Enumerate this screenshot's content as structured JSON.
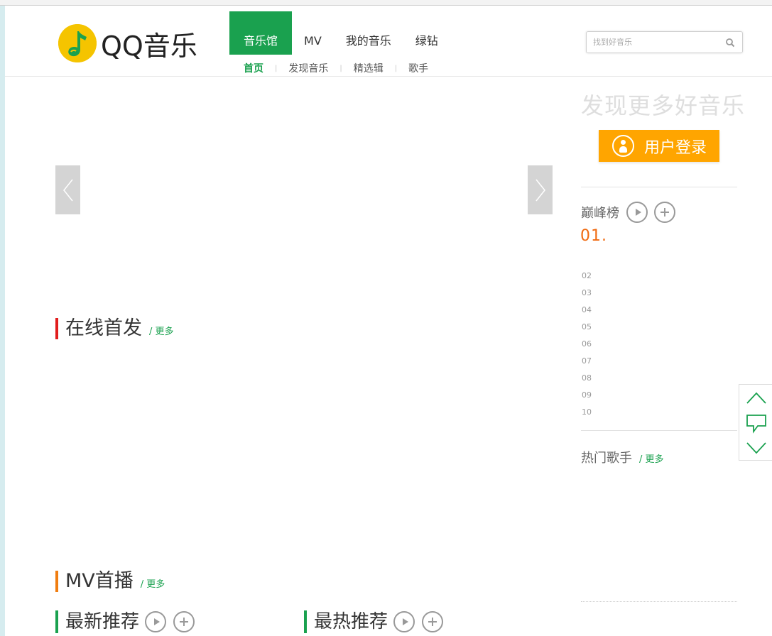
{
  "brand": {
    "name": "QQ音乐",
    "color": "#1aa14f",
    "logo_color": "#f5c400"
  },
  "nav": {
    "items": [
      {
        "label": "音乐馆",
        "active": true
      },
      {
        "label": "MV"
      },
      {
        "label": "我的音乐"
      },
      {
        "label": "绿钻"
      }
    ]
  },
  "subnav": {
    "items": [
      {
        "label": "首页",
        "active": true
      },
      {
        "label": "发现音乐"
      },
      {
        "label": "精选辑"
      },
      {
        "label": "歌手"
      }
    ],
    "separator": "|"
  },
  "search": {
    "placeholder": "找到好音乐",
    "icon": "search-icon"
  },
  "slider": {
    "prev_icon": "chevron-left-icon",
    "next_icon": "chevron-right-icon"
  },
  "sections": {
    "online_release": {
      "title": "在线首发",
      "more": "更多",
      "accent": "#e11d1d"
    },
    "mv_premiere": {
      "title": "MV首播",
      "more": "更多",
      "accent": "#f07d10"
    },
    "latest": {
      "title": "最新推荐"
    },
    "hottest": {
      "title": "最热推荐"
    }
  },
  "sidebar": {
    "heading": "发现更多好音乐",
    "login_label": "用户登录",
    "login_color": "#ffa500",
    "chart": {
      "title": "巅峰榜",
      "first_rank": "01.",
      "ranks": [
        "02",
        "03",
        "04",
        "05",
        "06",
        "07",
        "08",
        "09",
        "10"
      ]
    },
    "hot_singers": {
      "title": "热门歌手",
      "more": "更多"
    }
  },
  "float_tools": {
    "up_icon": "chevron-up-icon",
    "feedback_icon": "feedback-icon",
    "down_icon": "chevron-down-icon"
  },
  "separator_slash": "/"
}
